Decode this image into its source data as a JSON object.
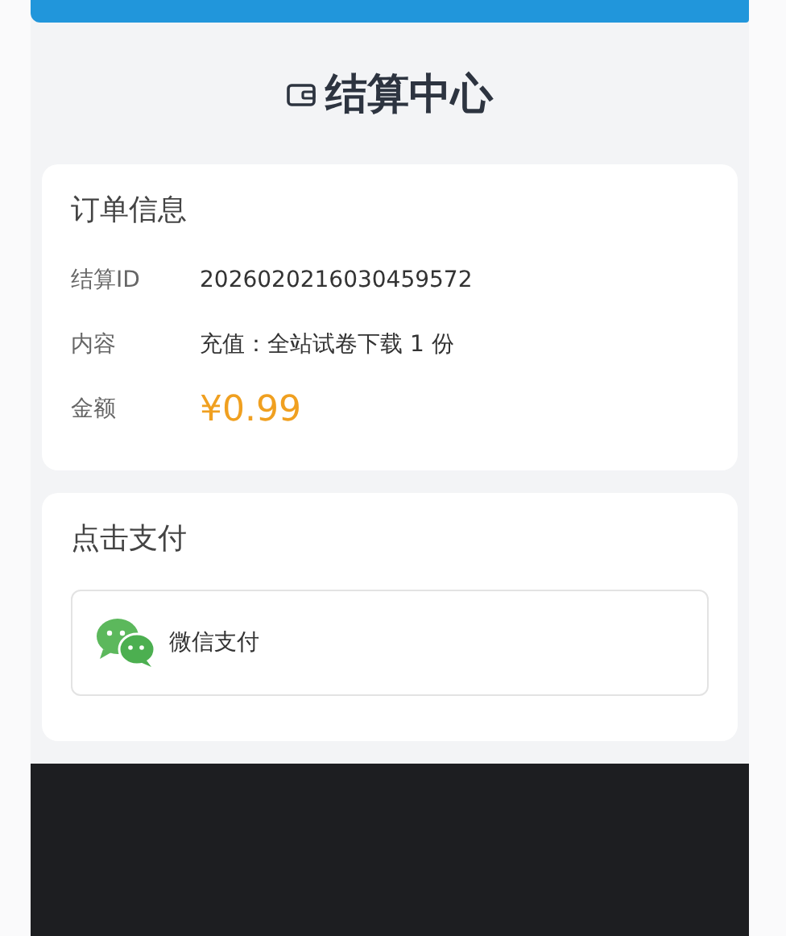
{
  "title": "结算中心",
  "order": {
    "heading": "订单信息",
    "rows": [
      {
        "label": "结算ID",
        "value": "2026020216030459572",
        "kind": "text"
      },
      {
        "label": "内容",
        "value": "充值：全站试卷下载 1 份",
        "kind": "text"
      },
      {
        "label": "金额",
        "value": "¥0.99",
        "kind": "amount"
      }
    ]
  },
  "payment": {
    "heading": "点击支付",
    "methods": [
      {
        "label": "微信支付",
        "kind": "wechat"
      }
    ]
  }
}
